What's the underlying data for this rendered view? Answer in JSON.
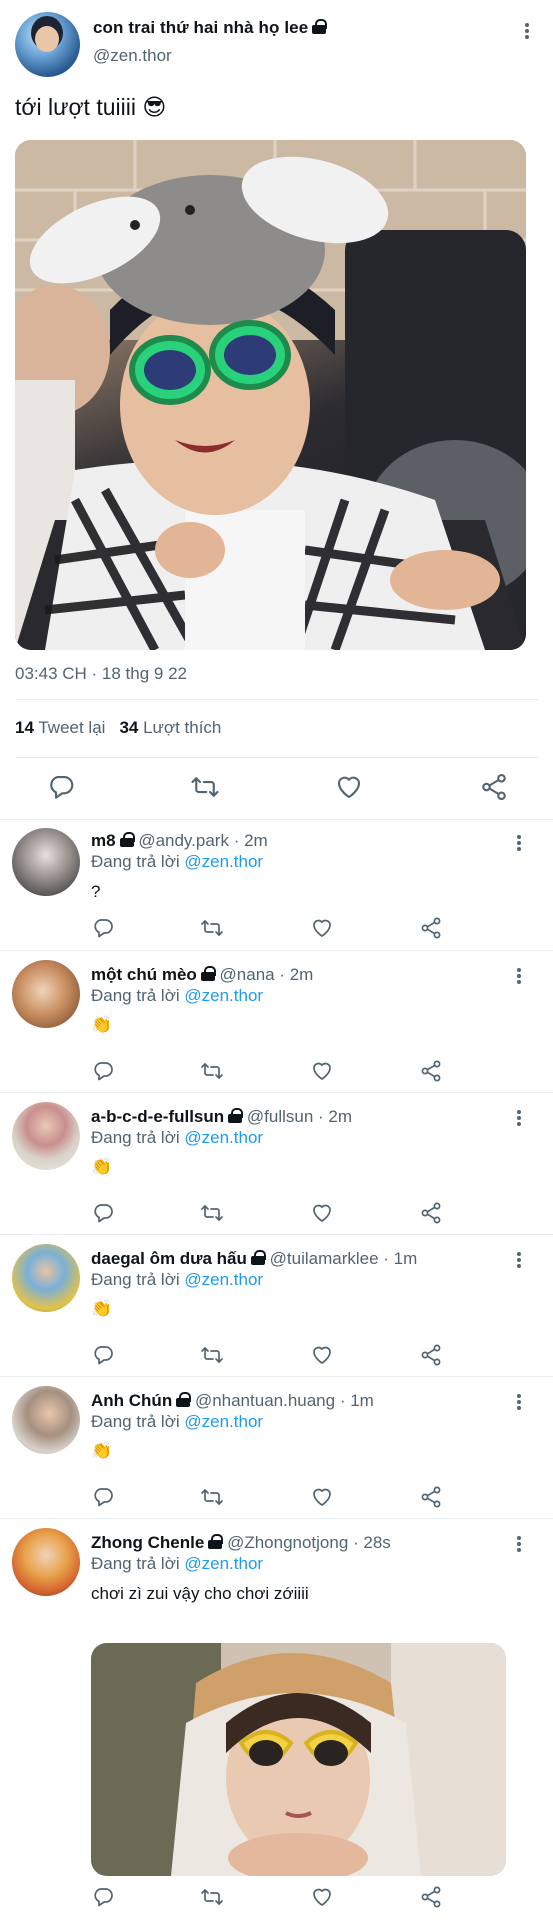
{
  "tweet": {
    "display_name": "con trai thứ hai nhà họ lee",
    "handle": "@zen.thor",
    "text": "tới lượt tuiiii 😎",
    "time": "03:43 CH · 18 thg 9 22",
    "retweets_count": "14",
    "retweets_label": "Tweet lại",
    "likes_count": "34",
    "likes_label": "Lượt thích"
  },
  "replying_prefix": "Đang trả lời",
  "replies": [
    {
      "name": "m8",
      "handle": "@andy.park · 2m",
      "replying_to": "@zen.thor",
      "text": "?"
    },
    {
      "name": "một chú mèo",
      "handle": "@nana · 2m",
      "replying_to": "@zen.thor",
      "text": "👏"
    },
    {
      "name": "a-b-c-d-e-fullsun",
      "handle": "@fullsun · 2m",
      "replying_to": "@zen.thor",
      "text": "👏"
    },
    {
      "name": "daegal ôm dưa hấu",
      "handle": "@tuilamarklee · 1m",
      "replying_to": "@zen.thor",
      "text": "👏"
    },
    {
      "name": "Anh Chún",
      "handle": "@nhantuan.huang · 1m",
      "replying_to": "@zen.thor",
      "text": "👏"
    },
    {
      "name": "Zhong Chenle",
      "handle": "@Zhongnotjong · 28s",
      "replying_to": "@zen.thor",
      "text": "chơi zì zui vậy cho chơi zớiiii"
    }
  ],
  "icons": {
    "reply": "reply-icon",
    "retweet": "retweet-icon",
    "like": "heart-icon",
    "share": "share-icon",
    "more": "more-dots-icon",
    "lock": "lock-icon"
  },
  "colors": {
    "link": "#1d9bf0",
    "secondary_text": "#536471",
    "icon": "#536471",
    "divider": "#e6ecf0"
  }
}
